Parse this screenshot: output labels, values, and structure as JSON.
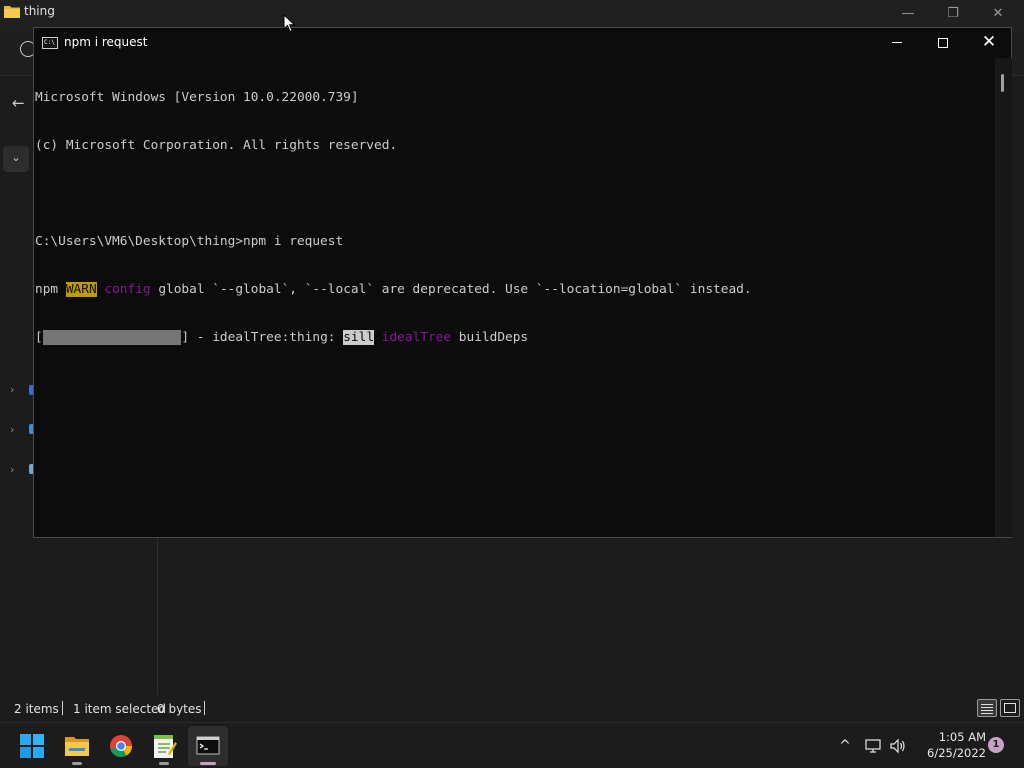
{
  "explorer": {
    "title": "thing",
    "status": {
      "items": "2 items",
      "selected": "1 item selected",
      "size": "0 bytes"
    }
  },
  "console": {
    "title": "npm i request",
    "lines": {
      "l1": "Microsoft Windows [Version 10.0.22000.739]",
      "l2": "(c) Microsoft Corporation. All rights reserved.",
      "l3": "",
      "l4": "C:\\Users\\VM6\\Desktop\\thing>npm i request",
      "l5_npm": "npm ",
      "l5_warn": "WARN",
      "l5_config": "config",
      "l5_rest": " global `--global`, `--local` are deprecated. Use `--location=global` instead.",
      "l6_open": "[",
      "l6_bar": "                  ",
      "l6_mid": "] - idealTree:thing: ",
      "l6_sill": "sill",
      "l6_idealtree": "idealTree",
      "l6_end": " buildDeps"
    },
    "progress_fraction": 1.0
  },
  "taskbar": {
    "apps": [
      {
        "name": "Start",
        "icon": "windows-start-icon"
      },
      {
        "name": "File Explorer",
        "icon": "file-explorer-icon"
      },
      {
        "name": "Google Chrome",
        "icon": "chrome-icon"
      },
      {
        "name": "Notepad++",
        "icon": "notepad-icon"
      },
      {
        "name": "Command Prompt",
        "icon": "terminal-icon"
      }
    ],
    "tray": {
      "chevron": "^",
      "time": "1:05 AM",
      "date": "6/25/2022",
      "notifications": "1"
    }
  },
  "colors": {
    "console_bg": "#0c0c0c",
    "console_text": "#cccccc",
    "warn_bg": "#c19c00",
    "magenta": "#881798",
    "accent": "#c7a2c5"
  }
}
